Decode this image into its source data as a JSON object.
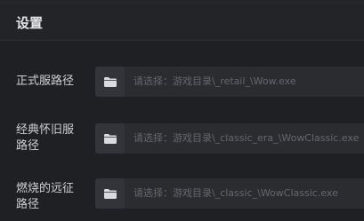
{
  "tabs": [
    "",
    "",
    "",
    ""
  ],
  "header": {
    "title": "设置"
  },
  "paths": [
    {
      "label": "正式服路径",
      "placeholder": "请选择：游戏目录\\_retail_\\Wow.exe"
    },
    {
      "label_line1": "经典怀旧服",
      "label_line2": "路径",
      "placeholder": "请选择：游戏目录\\_classic_era_\\WowClassic.exe"
    },
    {
      "label_line1": "燃烧的远征",
      "label_line2": "路径",
      "placeholder": "请选择：游戏目录\\_classic_\\WowClassic.exe"
    }
  ],
  "icons": {
    "folder": "folder-icon"
  },
  "colors": {
    "background": "#1f2023",
    "field": "#2b2c30",
    "button": "#333439",
    "icon": "#d9dade"
  }
}
